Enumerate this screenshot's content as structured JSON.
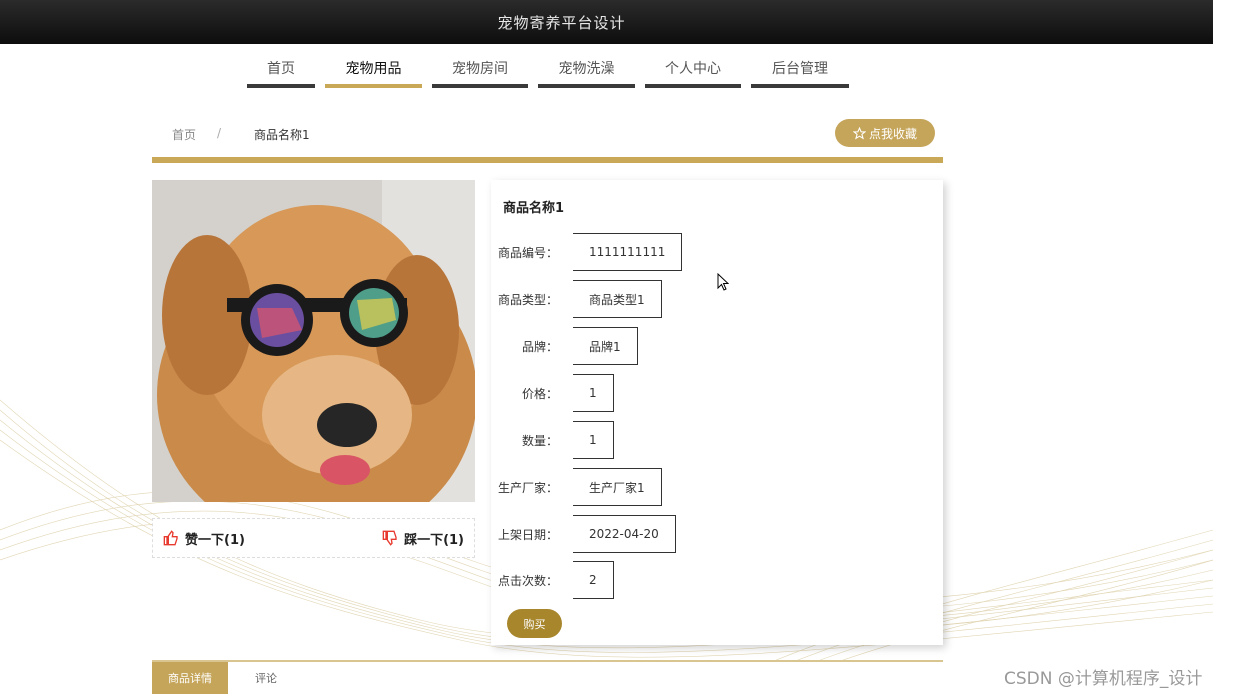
{
  "app": {
    "title": "宠物寄养平台设计"
  },
  "nav": {
    "items": [
      {
        "label": "首页",
        "active": false
      },
      {
        "label": "宠物用品",
        "active": true
      },
      {
        "label": "宠物房间",
        "active": false
      },
      {
        "label": "宠物洗澡",
        "active": false
      },
      {
        "label": "个人中心",
        "active": false
      },
      {
        "label": "后台管理",
        "active": false
      }
    ]
  },
  "breadcrumb": {
    "home": "首页",
    "separator": "/",
    "current": "商品名称1"
  },
  "favorite": {
    "icon": "star-outline-icon",
    "label": "点我收藏"
  },
  "product": {
    "name": "商品名称1",
    "fields": [
      {
        "label": "商品编号：",
        "value": "1111111111"
      },
      {
        "label": "商品类型：",
        "value": "商品类型1"
      },
      {
        "label": "品牌：",
        "value": "品牌1"
      },
      {
        "label": "价格：",
        "value": "1"
      },
      {
        "label": "数量：",
        "value": "1"
      },
      {
        "label": "生产厂家：",
        "value": "生产厂家1"
      },
      {
        "label": "上架日期：",
        "value": "2022-04-20"
      },
      {
        "label": "点击次数：",
        "value": "2"
      }
    ],
    "buy_label": "购买"
  },
  "votes": {
    "like": {
      "icon": "thumbs-up-icon",
      "label": "赞一下(1)"
    },
    "dislike": {
      "icon": "thumbs-down-icon",
      "label": "踩一下(1)"
    }
  },
  "tabs": [
    {
      "label": "商品详情",
      "active": true
    },
    {
      "label": "评论",
      "active": false
    }
  ],
  "watermark": "CSDN @计算机程序_设计",
  "colors": {
    "accent": "#c9a858",
    "topbar": "#151515",
    "buy": "#a7862c",
    "vote_icon": "#e8392f"
  }
}
